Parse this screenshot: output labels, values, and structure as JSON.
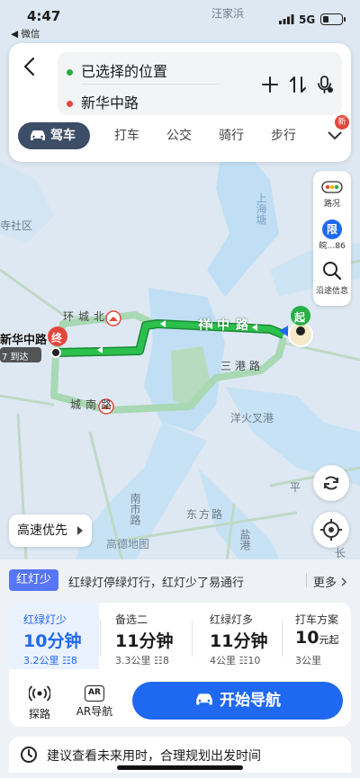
{
  "status_bar": {
    "time": "4:47",
    "back_app": "◀ 微信",
    "network": "5G"
  },
  "map": {
    "labels": {
      "wangjiabang": "汪家浜",
      "shanghai_port": "上海塘",
      "si_community": "寺社区",
      "huancheng_bei": "环城北",
      "xiangzhong_road": "祥中路",
      "sangang_road": "三港路",
      "chengnan_road": "城南路",
      "yanghuochacha": "洋火叉港",
      "nanshi_road": "南市路",
      "dongfang_road": "东方路",
      "ping_label": "平",
      "yangang": "盐港",
      "gaode_map": "高德地图",
      "chang_label": "长"
    },
    "end_place": "新华中路",
    "end_arrive": "7 到达",
    "end_marker": "终",
    "start_marker": "起",
    "route_color": "#27b045",
    "alt_route_color": "#a9d8b4"
  },
  "search": {
    "from": "已选择的位置",
    "to": "新华中路",
    "from_color": "#27b045",
    "to_color": "#e5463c"
  },
  "tabs": [
    "驾车",
    "打车",
    "公交",
    "骑行",
    "步行"
  ],
  "tabs_more_badge": "新",
  "tools": {
    "traffic": "路况",
    "limit_icon": "限",
    "limit": "皖…86",
    "along": "沿途信息"
  },
  "preference": "高速优先",
  "tip": {
    "badge": "红灯少",
    "text": "红绿灯停绿灯行，红灯少了易通行",
    "more": "更多"
  },
  "routes": [
    {
      "name": "红绿灯少",
      "time": "10分钟",
      "meta_km": "3.2公里",
      "meta_lights": "8"
    },
    {
      "name": "备选二",
      "time": "11分钟",
      "meta_km": "3.3公里",
      "meta_lights": "8"
    },
    {
      "name": "红绿灯多",
      "time": "11分钟",
      "meta_km": "4公里",
      "meta_lights": "10"
    },
    {
      "name": "打车方案",
      "time": "10",
      "time_unit": "元起",
      "meta_km": "3公里"
    }
  ],
  "bottom_buttons": {
    "explore": "探路",
    "ar": "AR导航",
    "ar_icon": "AR",
    "start": "开始导航"
  },
  "suggest": "建议查看未来用时，合理规划出发时间",
  "colors": {
    "accent": "#1f68f0",
    "tab_active": "#3c4d67",
    "tip_badge": "#5676f6"
  }
}
